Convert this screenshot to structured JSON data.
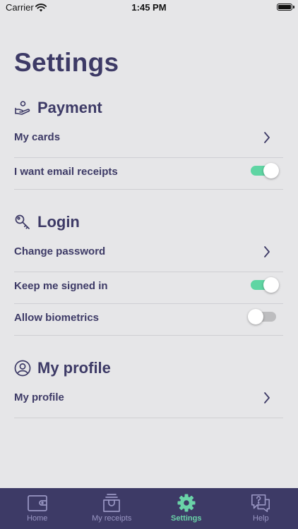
{
  "status_bar": {
    "carrier": "Carrier",
    "time": "1:45 PM"
  },
  "page": {
    "title": "Settings"
  },
  "sections": {
    "payment": {
      "title": "Payment",
      "icon": "hand-coin-icon",
      "rows": {
        "my_cards": {
          "label": "My cards"
        },
        "email_receipts": {
          "label": "I want email receipts",
          "enabled": true
        }
      }
    },
    "login": {
      "title": "Login",
      "icon": "key-icon",
      "rows": {
        "change_password": {
          "label": "Change password"
        },
        "keep_signed_in": {
          "label": "Keep me signed in",
          "enabled": true
        },
        "allow_biometrics": {
          "label": "Allow biometrics",
          "enabled": false
        }
      }
    },
    "profile": {
      "title": "My profile",
      "icon": "user-circle-icon",
      "rows": {
        "my_profile": {
          "label": "My profile"
        }
      }
    }
  },
  "tab_bar": {
    "tabs": [
      {
        "label": "Home",
        "icon": "wallet-icon",
        "active": false
      },
      {
        "label": "My receipts",
        "icon": "receipt-box-icon",
        "active": false
      },
      {
        "label": "Settings",
        "icon": "gear-icon",
        "active": true
      },
      {
        "label": "Help",
        "icon": "help-chat-icon",
        "active": false
      }
    ]
  },
  "colors": {
    "background": "#e6e6e8",
    "primary": "#3d3a66",
    "accent_green": "#5fd5a3",
    "toggle_off": "#bdbdbf",
    "tab_inactive": "#9a97c4",
    "tab_active": "#6ad3a8"
  }
}
